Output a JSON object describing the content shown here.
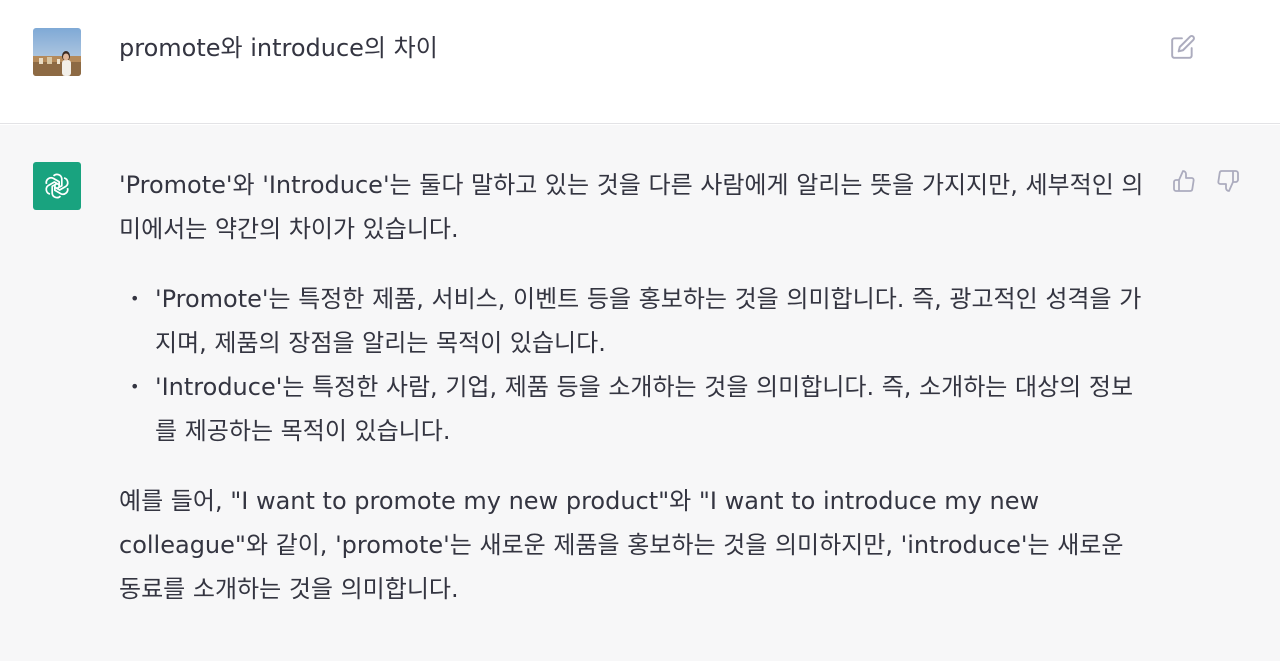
{
  "conversation": {
    "user_message": {
      "avatar": "user-photo-avatar",
      "text": "promote와 introduce의 차이",
      "edit_icon": "edit-icon"
    },
    "assistant_message": {
      "avatar": "openai-logo-icon",
      "intro": "'Promote'와 'Introduce'는 둘다 말하고 있는 것을 다른 사람에게 알리는 뜻을 가지지만, 세부적인 의미에서는 약간의 차이가 있습니다.",
      "bullets": [
        "'Promote'는 특정한 제품, 서비스, 이벤트 등을 홍보하는 것을 의미합니다. 즉, 광고적인 성격을 가지며, 제품의 장점을 알리는 목적이 있습니다.",
        "'Introduce'는 특정한 사람, 기업, 제품 등을 소개하는 것을 의미합니다. 즉, 소개하는 대상의 정보를 제공하는 목적이 있습니다."
      ],
      "example": "예를 들어, \"I want to promote my new product\"와 \"I want to introduce my new colleague\"와 같이, 'promote'는 새로운 제품을 홍보하는 것을 의미하지만, 'introduce'는 새로운 동료를 소개하는 것을 의미합니다.",
      "feedback_icons": [
        "thumbs-up-icon",
        "thumbs-down-icon"
      ]
    }
  },
  "colors": {
    "user_bg": "#ffffff",
    "assistant_bg": "#f7f7f8",
    "text": "#343541",
    "icon": "#acacbe",
    "gpt_avatar": "#19a37f"
  }
}
